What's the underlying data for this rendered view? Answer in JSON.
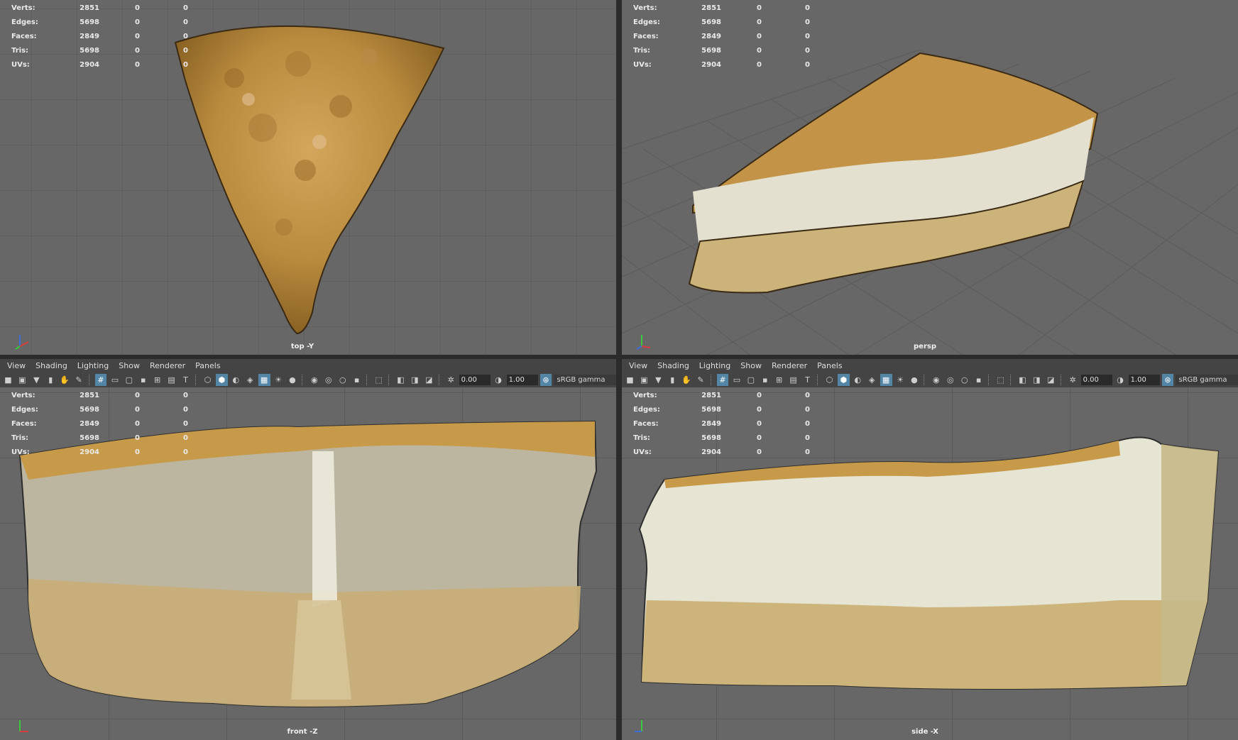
{
  "stats": [
    {
      "label": "Verts:",
      "v1": "2851",
      "v2": "0",
      "v3": "0"
    },
    {
      "label": "Edges:",
      "v1": "5698",
      "v2": "0",
      "v3": "0"
    },
    {
      "label": "Faces:",
      "v1": "2849",
      "v2": "0",
      "v3": "0"
    },
    {
      "label": "Tris:",
      "v1": "5698",
      "v2": "0",
      "v3": "0"
    },
    {
      "label": "UVs:",
      "v1": "2904",
      "v2": "0",
      "v3": "0"
    }
  ],
  "viewports": {
    "top": {
      "label": "top -Y"
    },
    "persp": {
      "label": "persp"
    },
    "front": {
      "label": "front -Z"
    },
    "side": {
      "label": "side -X"
    }
  },
  "menu": [
    "View",
    "Shading",
    "Lighting",
    "Show",
    "Renderer",
    "Panels"
  ],
  "toolbar": {
    "exposure": "0.00",
    "gamma": "1.00",
    "colorspace": "sRGB gamma"
  },
  "colors": {
    "viewport_bg": "#676767",
    "grid": "#575757",
    "toolbar_bg": "#444444",
    "active_button": "#5285a6",
    "crust": "#c8963a",
    "filling": "#e8e6d8",
    "base": "#c9b07a"
  }
}
